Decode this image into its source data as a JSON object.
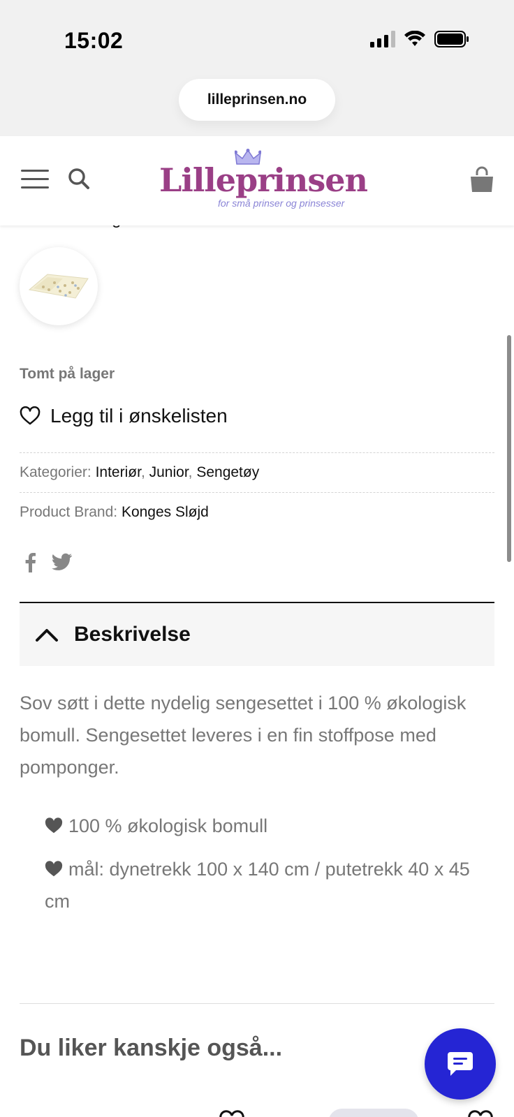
{
  "status_bar": {
    "time": "15:02"
  },
  "browser": {
    "url": "lilleprinsen.no"
  },
  "header": {
    "logo_text": "Lilleprinsen",
    "logo_tagline": "for små prinser og prinsesser"
  },
  "product": {
    "other_colors_label": "Se andre farger",
    "stock_status": "Tomt på lager",
    "wishlist_label": "Legg til i ønskelisten",
    "categories_label": "Kategorier:",
    "categories": [
      "Interiør",
      "Junior",
      "Sengetøy"
    ],
    "brand_label": "Product Brand:",
    "brand": "Konges Sløjd"
  },
  "description": {
    "tab_title": "Beskrivelse",
    "text": "Sov søtt i dette nydelig sengesettet i 100 % økologisk bomull. Sengesettet leveres i en fin stoffpose med pomponger.",
    "bullets": [
      "100 % økologisk bomull",
      "mål: dynetrekk 100 x 140 cm / putetrekk 40 x 45 cm"
    ]
  },
  "related": {
    "title": "Du liker kanskje også..."
  },
  "colors": {
    "logo": "#9a3f86",
    "tagline": "#8a84d6",
    "chat": "#2525d4",
    "muted": "#777777"
  },
  "icons": [
    "hamburger-icon",
    "search-icon",
    "crown-icon",
    "cart-icon",
    "heart-outline-icon",
    "facebook-icon",
    "twitter-icon",
    "chevron-up-icon",
    "heart-filled-icon",
    "chat-bubble-icon"
  ]
}
